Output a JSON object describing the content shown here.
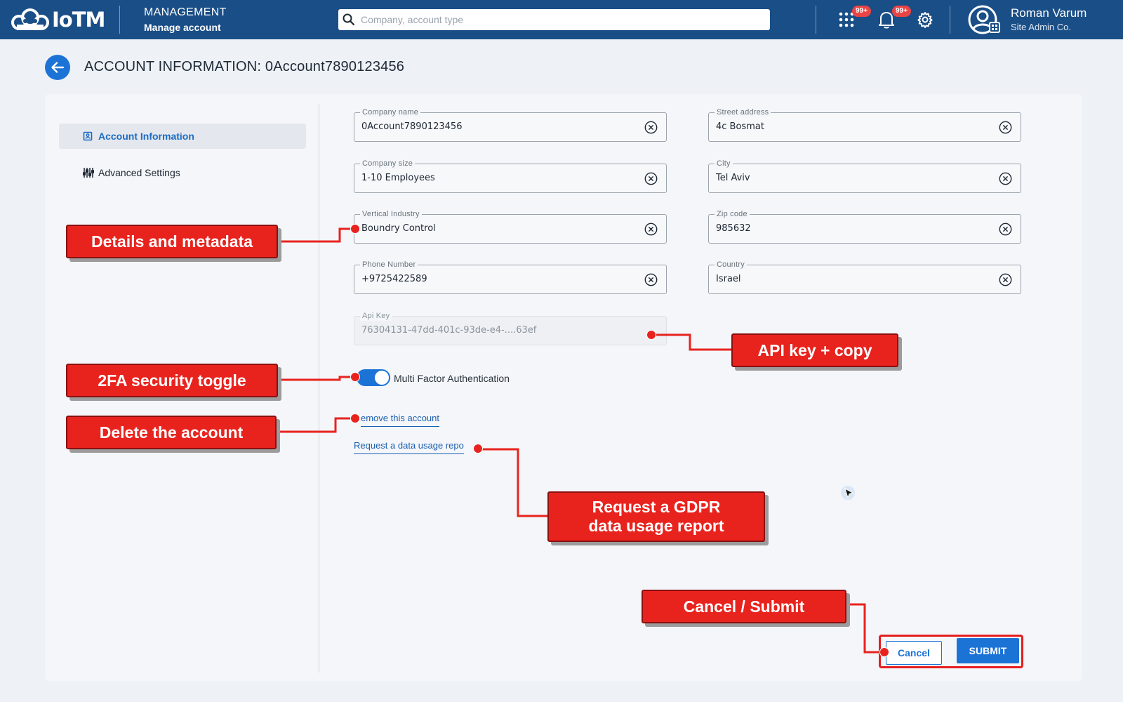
{
  "app": {
    "logo_text": "IoTM",
    "section_title": "MANAGEMENT",
    "section_subtitle": "Manage account"
  },
  "search": {
    "placeholder": "Company, account type",
    "icon": "search-icon"
  },
  "header_icons": {
    "apps_badge": "99+",
    "notifications_badge": "99+"
  },
  "user": {
    "name": "Roman Varum",
    "org": "Site Admin Co."
  },
  "page": {
    "title": "ACCOUNT INFORMATION: 0Account7890123456"
  },
  "sidebar": {
    "items": [
      {
        "label": "Account Information",
        "icon": "account-card-icon",
        "active": true
      },
      {
        "label": "Advanced Settings",
        "icon": "sliders-icon",
        "active": false
      }
    ]
  },
  "form": {
    "company_name": {
      "label": "Company name",
      "value": "0Account7890123456"
    },
    "company_size": {
      "label": "Company size",
      "value": "1-10 Employees"
    },
    "vertical_industry": {
      "label": "Vertical Industry",
      "value": "Boundry Control"
    },
    "phone_number": {
      "label": "Phone Number",
      "value": "+9725422589"
    },
    "api_key": {
      "label": "Api Key",
      "value": "76304131-47dd-401c-93de-e4-....63ef"
    },
    "street_address": {
      "label": "Street address",
      "value": "4c Bosmat"
    },
    "city": {
      "label": "City",
      "value": "Tel Aviv"
    },
    "zip_code": {
      "label": "Zip code",
      "value": "985632"
    },
    "country": {
      "label": "Country",
      "value": "Israel"
    },
    "mfa": {
      "label": "Multi Factor Authentication",
      "enabled": true
    },
    "remove_link": "emove this account",
    "report_link": "Request a data usage repo"
  },
  "actions": {
    "cancel": "Cancel",
    "submit": "SUBMIT"
  },
  "annotations": {
    "details": "Details and metadata",
    "api": "API key + copy",
    "twofa": "2FA security toggle",
    "delete": "Delete the account",
    "gdpr_line1": "Request a GDPR",
    "gdpr_line2": "data usage report",
    "cancel_submit": "Cancel / Submit"
  },
  "colors": {
    "topbar": "#1a4e86",
    "primary": "#1c73d6",
    "annotation": "#e8231e",
    "badge": "#e94545"
  }
}
